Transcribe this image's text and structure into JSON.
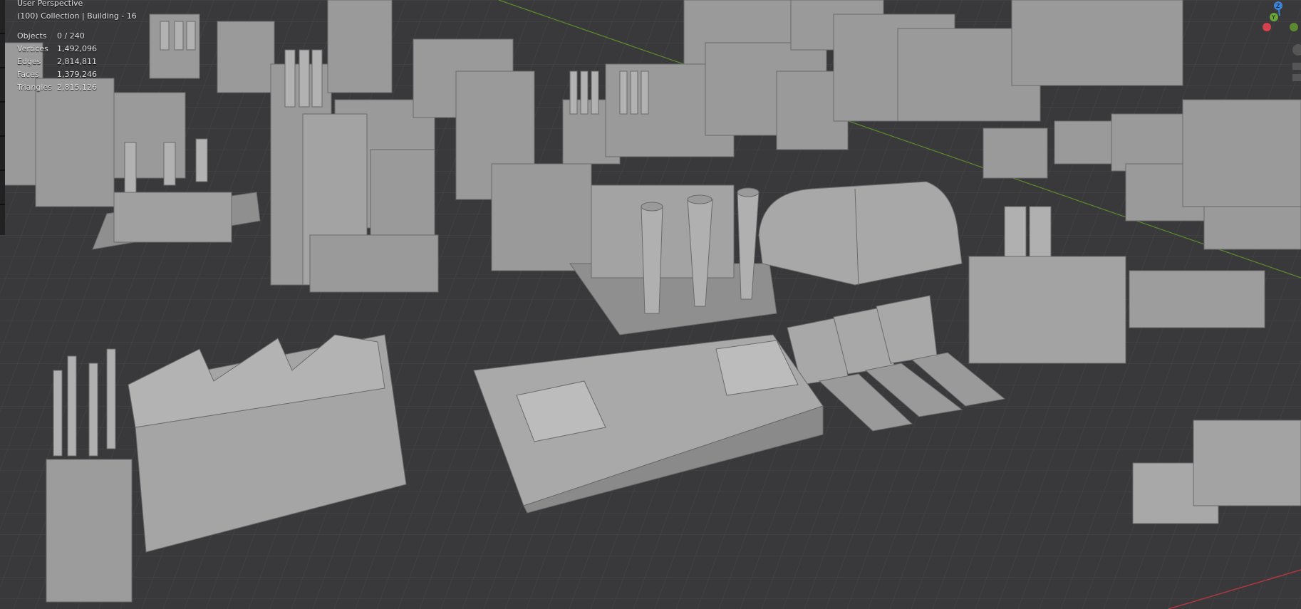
{
  "viewport": {
    "perspective_label": "User Perspective",
    "collection_label": "(100) Collection | Building - 16"
  },
  "stats": [
    {
      "label": "Objects",
      "value": "0 / 240"
    },
    {
      "label": "Vertices",
      "value": "1,492,096"
    },
    {
      "label": "Edges",
      "value": "2,814,811"
    },
    {
      "label": "Faces",
      "value": "1,379,246"
    },
    {
      "label": "Triangles",
      "value": "2,815,126"
    }
  ],
  "gizmo": {
    "z_label": "Z",
    "y_label": "Y",
    "x_color": "#d4434d",
    "y_color": "#6ba438",
    "z_color": "#3d84d6"
  },
  "colors": {
    "grid_background": "#3a3a3c",
    "grid_line": "#4a4a4c",
    "building_light": "#a9a9a9",
    "building_mid": "#8f8f8f",
    "building_dark": "#6e6e6e"
  }
}
